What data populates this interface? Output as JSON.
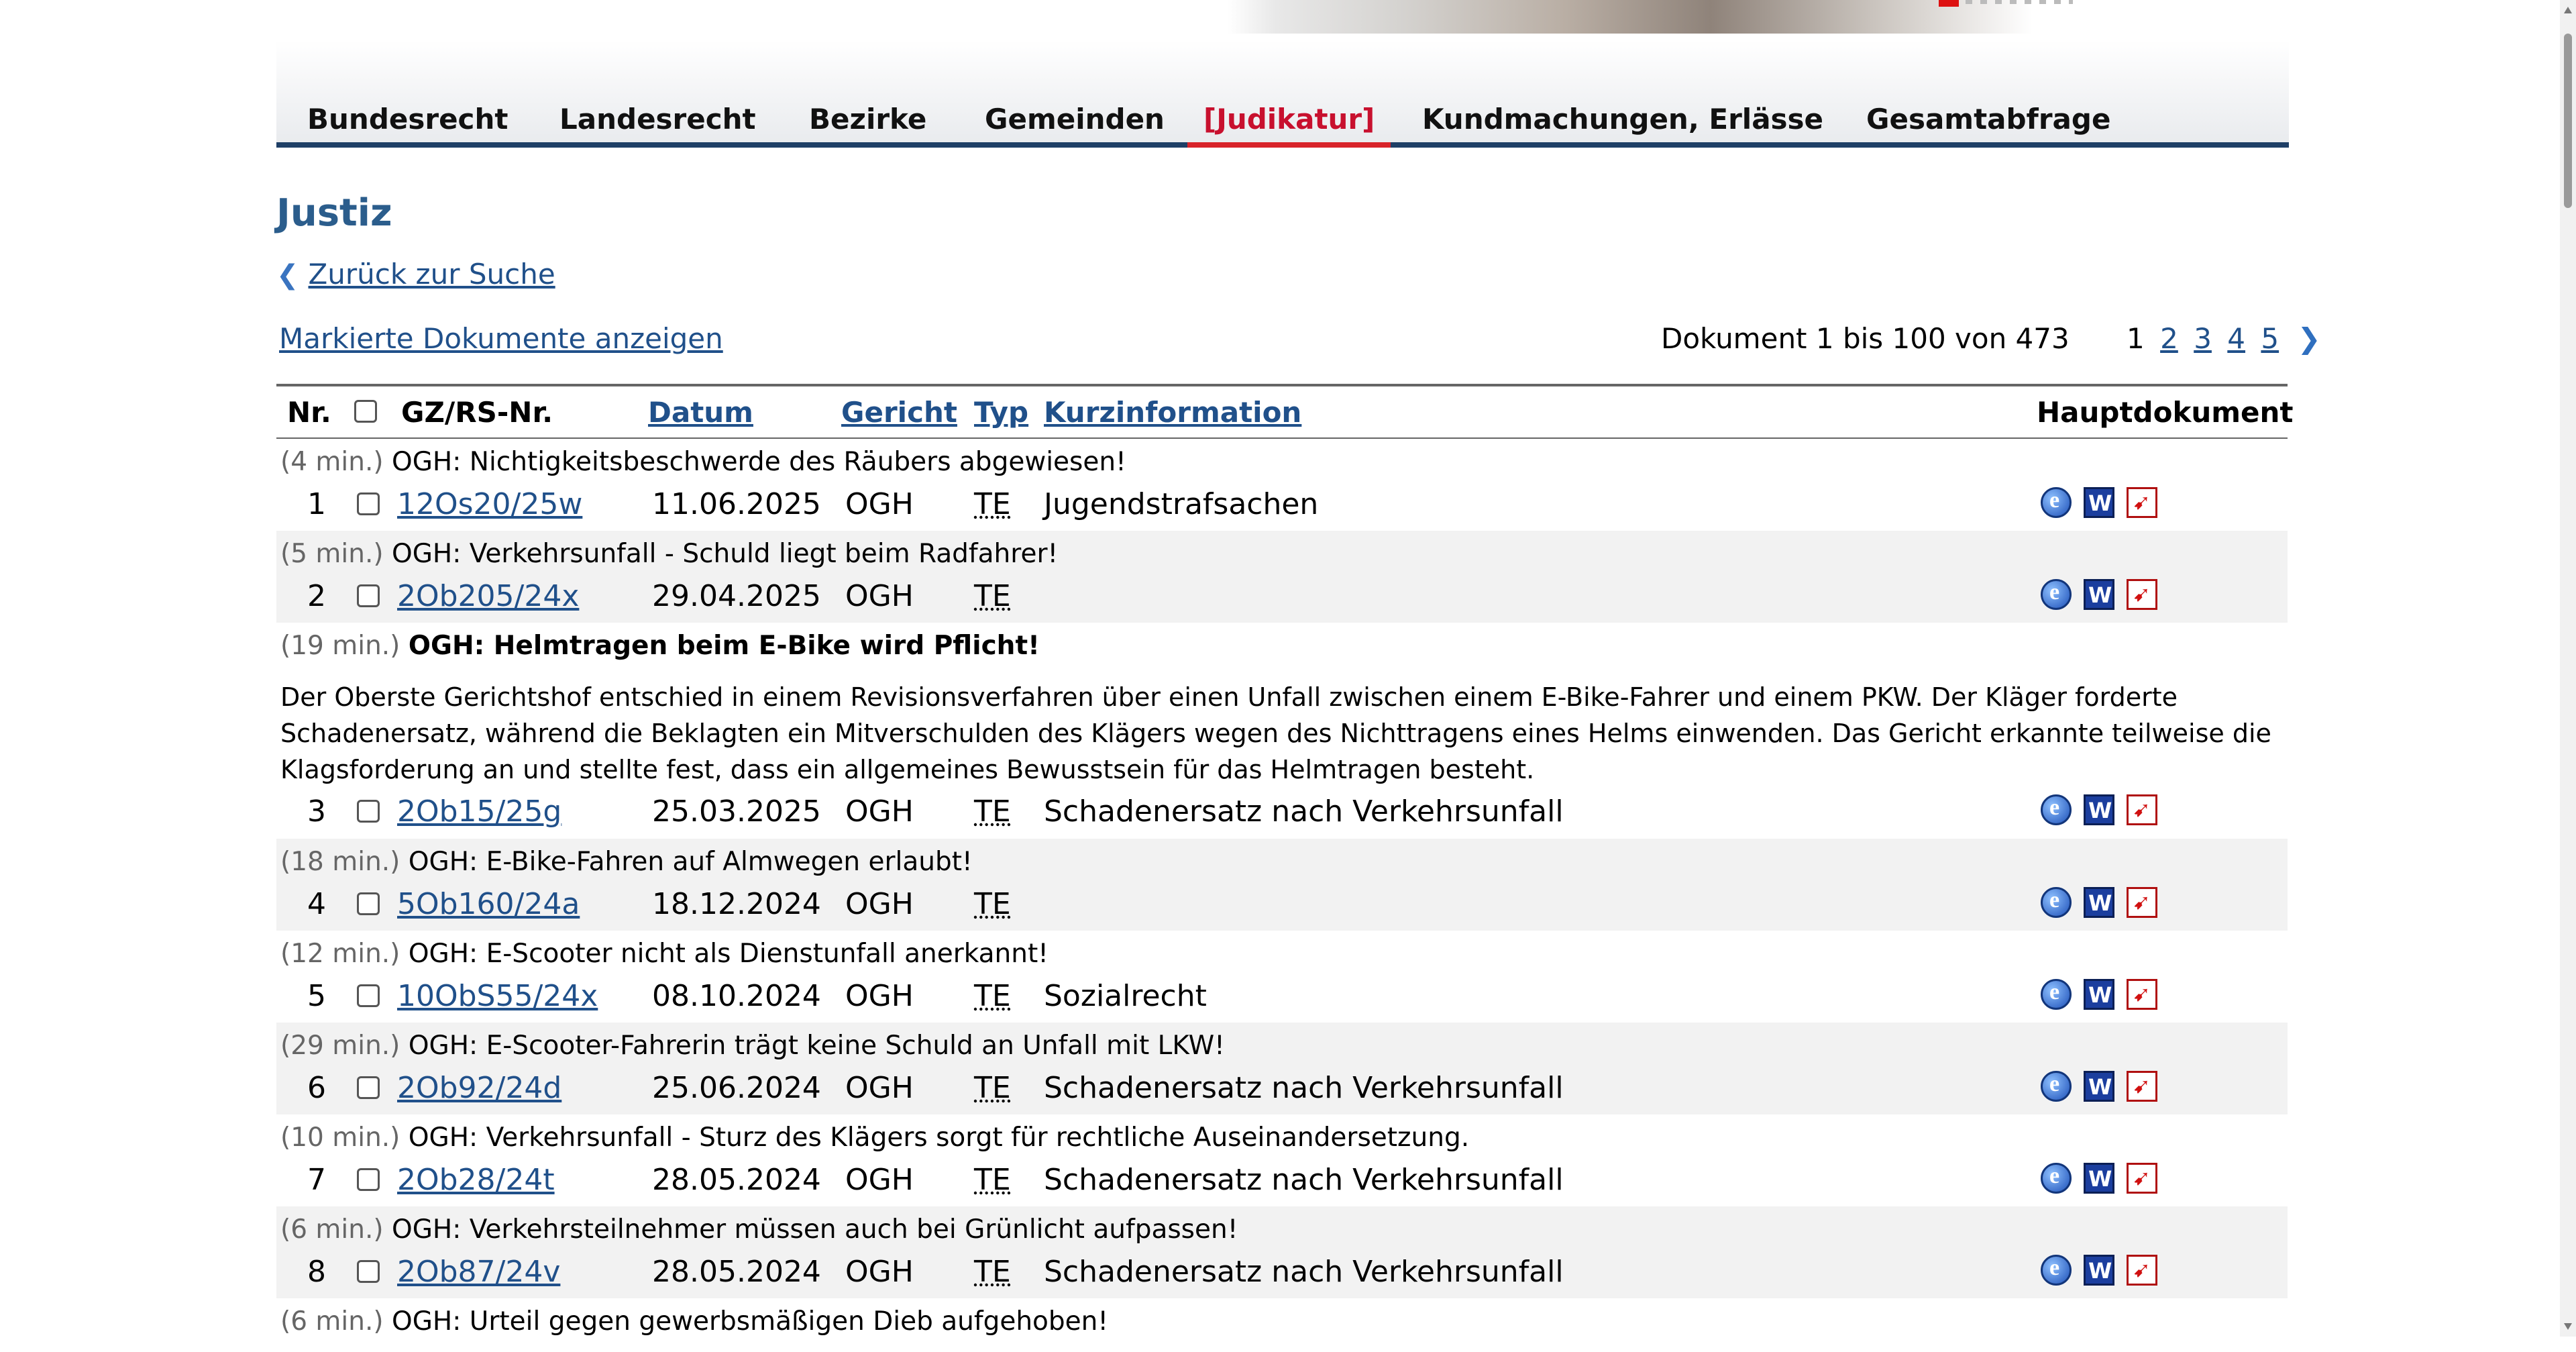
{
  "nav": {
    "tabs": [
      {
        "label": "Bundesrecht"
      },
      {
        "label": "Landesrecht"
      },
      {
        "label": "Bezirke"
      },
      {
        "label": "Gemeinden"
      },
      {
        "label": "[Judikatur]"
      },
      {
        "label": "Kundmachungen, Erlässe"
      },
      {
        "label": "Gesamtabfrage"
      }
    ]
  },
  "page": {
    "title": "Justiz",
    "back_link": "Zurück zur Suche",
    "marked_link": "Markierte Dokumente anzeigen",
    "doc_range": "Dokument 1 bis 100 von 473"
  },
  "pager": {
    "current": "1",
    "pages": [
      "2",
      "3",
      "4",
      "5"
    ],
    "next_icon": "chevron-right-icon"
  },
  "table": {
    "headers": {
      "nr": "Nr.",
      "gz": "GZ/RS-Nr.",
      "datum": "Datum",
      "gericht": "Gericht",
      "typ": "Typ",
      "kurz": "Kurzinformation",
      "haupt": "Hauptdokument"
    },
    "rows": [
      {
        "min": "(4 min.)",
        "summary": "OGH: Nichtigkeitsbeschwerde des Räubers abgewiesen!",
        "nr": "1",
        "gz": "12Os20/25w",
        "date": "11.06.2025",
        "court": "OGH",
        "typ": "TE",
        "kurz": "Jugendstrafsachen"
      },
      {
        "min": "(5 min.)",
        "summary": "OGH: Verkehrsunfall - Schuld liegt beim Radfahrer!",
        "nr": "2",
        "gz": "2Ob205/24x",
        "date": "29.04.2025",
        "court": "OGH",
        "typ": "TE",
        "kurz": ""
      },
      {
        "min": "(19 min.)",
        "summary": "OGH: Helmtragen beim E-Bike wird Pflicht!",
        "abstract": "Der Oberste Gerichtshof entschied in einem Revisionsverfahren über einen Unfall zwischen einem E-Bike-Fahrer und einem PKW. Der Kläger forderte Schadenersatz, während die Beklagten ein Mitverschulden des Klägers wegen des Nichttragens eines Helms einwenden. Das Gericht erkannte teilweise die Klagsforderung an und stellte fest, dass ein allgemeines Bewusstsein für das Helmtragen besteht.",
        "nr": "3",
        "gz": "2Ob15/25g",
        "date": "25.03.2025",
        "court": "OGH",
        "typ": "TE",
        "kurz": "Schadenersatz nach Verkehrsunfall"
      },
      {
        "min": "(18 min.)",
        "summary": "OGH: E-Bike-Fahren auf Almwegen erlaubt!",
        "nr": "4",
        "gz": "5Ob160/24a",
        "date": "18.12.2024",
        "court": "OGH",
        "typ": "TE",
        "kurz": ""
      },
      {
        "min": "(12 min.)",
        "summary": "OGH: E-Scooter nicht als Dienstunfall anerkannt!",
        "nr": "5",
        "gz": "10ObS55/24x",
        "date": "08.10.2024",
        "court": "OGH",
        "typ": "TE",
        "kurz": "Sozialrecht"
      },
      {
        "min": "(29 min.)",
        "summary": "OGH: E-Scooter-Fahrerin trägt keine Schuld an Unfall mit LKW!",
        "nr": "6",
        "gz": "2Ob92/24d",
        "date": "25.06.2024",
        "court": "OGH",
        "typ": "TE",
        "kurz": "Schadenersatz nach Verkehrsunfall"
      },
      {
        "min": "(10 min.)",
        "summary": "OGH: Verkehrsunfall - Sturz des Klägers sorgt für rechtliche Auseinandersetzung.",
        "nr": "7",
        "gz": "2Ob28/24t",
        "date": "28.05.2024",
        "court": "OGH",
        "typ": "TE",
        "kurz": "Schadenersatz nach Verkehrsunfall"
      },
      {
        "min": "(6 min.)",
        "summary": "OGH: Verkehrsteilnehmer müssen auch bei Grünlicht aufpassen!",
        "nr": "8",
        "gz": "2Ob87/24v",
        "date": "28.05.2024",
        "court": "OGH",
        "typ": "TE",
        "kurz": "Schadenersatz nach Verkehrsunfall"
      },
      {
        "min": "(6 min.)",
        "summary": "OGH: Urteil gegen gewerbsmäßigen Dieb aufgehoben!"
      }
    ]
  },
  "colors": {
    "accent_red": "#d8232a",
    "link_blue": "#20508a",
    "title_blue": "#2b5d8c",
    "nav_underline": "#1e3f66"
  }
}
